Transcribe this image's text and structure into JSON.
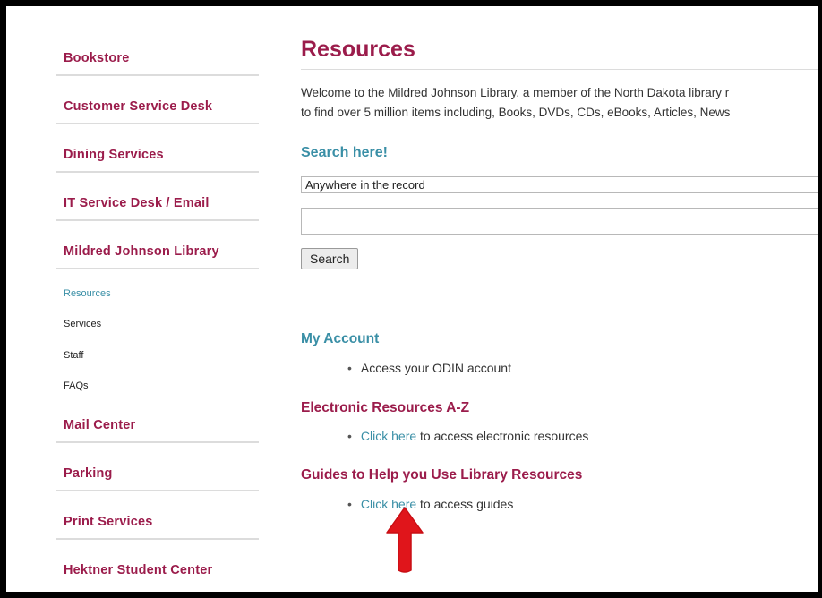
{
  "sidebar": {
    "items": [
      {
        "label": "Bookstore"
      },
      {
        "label": "Customer Service Desk"
      },
      {
        "label": "Dining Services"
      },
      {
        "label": "IT Service Desk / Email"
      },
      {
        "label": "Mildred Johnson Library"
      }
    ],
    "subitems": [
      {
        "label": "Resources",
        "active": true
      },
      {
        "label": "Services"
      },
      {
        "label": "Staff"
      },
      {
        "label": "FAQs"
      }
    ],
    "items2": [
      {
        "label": "Mail Center"
      },
      {
        "label": "Parking"
      },
      {
        "label": "Print Services"
      },
      {
        "label": "Hektner Student Center"
      }
    ]
  },
  "main": {
    "title": "Resources",
    "intro_line1": "Welcome to the Mildred Johnson Library, a member of the North Dakota library r",
    "intro_line2": "to find over 5 million items including, Books, DVDs, CDs, eBooks, Articles, News",
    "search": {
      "heading": "Search here!",
      "scope_selected": "Anywhere in the record",
      "input_value": "",
      "button_label": "Search"
    },
    "sections": [
      {
        "heading": "My Account",
        "bullet_text": "Access your ODIN account"
      },
      {
        "heading": "Electronic Resources A-Z",
        "link_text": "Click here",
        "bullet_text": " to access electronic resources"
      },
      {
        "heading": "Guides to Help you Use Library Resources",
        "link_text": "Click here",
        "bullet_text": " to access guides"
      }
    ]
  },
  "annotation": {
    "arrow_icon": "red-up-arrow-icon",
    "arrow_color": "#e0151b"
  },
  "colors": {
    "brand_maroon": "#9b1c4b",
    "accent_teal": "#3a8fa6"
  }
}
